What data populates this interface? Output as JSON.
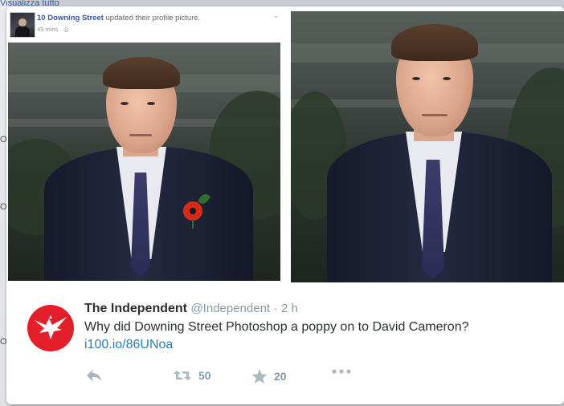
{
  "background": {
    "top_text": "Visualizza tutto",
    "side_glyphs": [
      "O",
      "O",
      "O"
    ]
  },
  "facebook_post": {
    "page_name": "10 Downing Street",
    "action": "updated their profile picture.",
    "time": "45 mins ·",
    "time_icon": "globe-icon",
    "menu_icon": "chevron-down-icon"
  },
  "tweet": {
    "account_name": "The Independent",
    "handle": "@Independent",
    "separator": "·",
    "time": "2 h",
    "text": "Why did Downing Street Photoshop a poppy on to David Cameron?",
    "link": "i100.io/86UNoa",
    "actions": {
      "reply_icon": "reply-icon",
      "retweet_icon": "retweet-icon",
      "retweet_count": "50",
      "favorite_icon": "star-icon",
      "favorite_count": "20",
      "more_icon": "more-dots-icon"
    },
    "colors": {
      "logo": "#e3202a",
      "link": "#2b7bb9",
      "text": "#292f33",
      "muted": "#8899a6"
    }
  }
}
